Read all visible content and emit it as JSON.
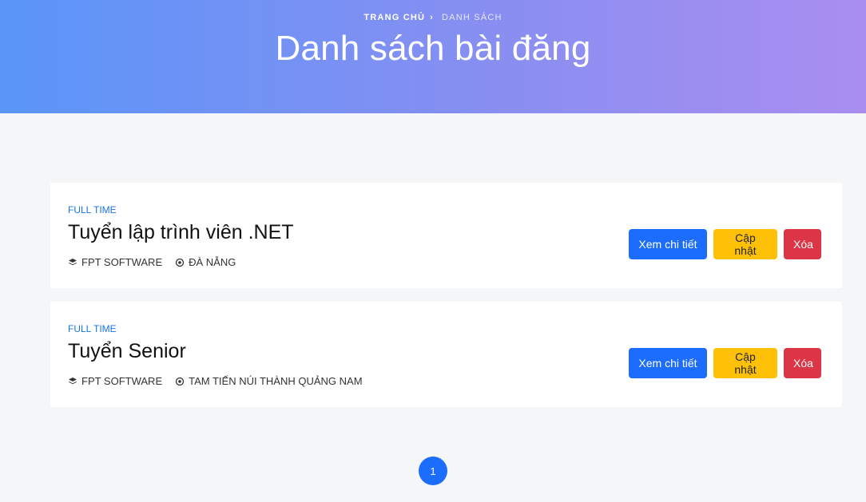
{
  "header": {
    "breadcrumb": {
      "home": "TRANG CHỦ",
      "separator": "›",
      "current": "DANH SÁCH"
    },
    "title": "Danh sách bài đăng"
  },
  "posts": [
    {
      "type": "FULL TIME",
      "title": "Tuyển lập trình viên .NET",
      "company": "FPT SOFTWARE",
      "location": "ĐÀ NẴNG",
      "actions": {
        "view": "Xem chi tiết",
        "edit": "Cập nhật",
        "delete": "Xóa"
      }
    },
    {
      "type": "FULL TIME",
      "title": "Tuyển Senior",
      "company": "FPT SOFTWARE",
      "location": "TAM TIẾN NÚI THÀNH QUẢNG NAM",
      "actions": {
        "view": "Xem chi tiết",
        "edit": "Cập nhật",
        "delete": "Xóa"
      }
    }
  ],
  "pagination": {
    "current_page": "1"
  },
  "colors": {
    "primary": "#1c6dfd",
    "warning": "#fec107",
    "danger": "#dc3545",
    "job_type": "#1a73e8",
    "hero_gradient_start": "#5a95f8",
    "hero_gradient_end": "#a98ef0"
  },
  "icons": {
    "company": "layers-icon",
    "location": "location-target-icon",
    "breadcrumb_separator": "chevron-right-icon"
  }
}
